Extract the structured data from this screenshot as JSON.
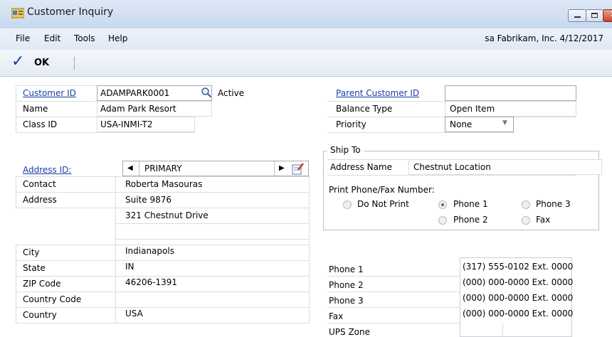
{
  "window": {
    "title": "Customer Inquiry"
  },
  "menu": {
    "file": "File",
    "edit": "Edit",
    "tools": "Tools",
    "help": "Help"
  },
  "status": {
    "company_info": "sa  Fabrikam, Inc. 4/12/2017"
  },
  "toolbar": {
    "ok_label": "OK"
  },
  "customer": {
    "id_label": "Customer ID",
    "id_value": "ADAMPARK0001",
    "status": "Active",
    "name_label": "Name",
    "name_value": "Adam Park Resort",
    "class_label": "Class ID",
    "class_value": "USA-INMI-T2"
  },
  "parent": {
    "parent_label": "Parent Customer ID",
    "parent_value": "",
    "balance_label": "Balance Type",
    "balance_value": "Open Item",
    "priority_label": "Priority",
    "priority_value": "None"
  },
  "address": {
    "id_label": "Address ID:",
    "id_value": "PRIMARY",
    "contact_label": "Contact",
    "contact_value": "Roberta Masouras",
    "address_label": "Address",
    "address_lines": [
      "Suite 9876",
      "321 Chestnut Drive",
      ""
    ],
    "city_label": "City",
    "city_value": "Indianapols",
    "state_label": "State",
    "state_value": "IN",
    "zip_label": "ZIP Code",
    "zip_value": "46206-1391",
    "country_code_label": "Country Code",
    "country_code_value": "",
    "country_label": "Country",
    "country_value": "USA"
  },
  "ship_to": {
    "group_label": "Ship To",
    "address_name_label": "Address Name",
    "address_name_value": "Chestnut Location",
    "print_label": "Print Phone/Fax Number:",
    "options": {
      "do_not_print": "Do Not Print",
      "phone1": "Phone 1",
      "phone2": "Phone 2",
      "phone3": "Phone 3",
      "fax": "Fax"
    },
    "selected": "phone1"
  },
  "phones": {
    "phone1_label": "Phone 1",
    "phone1_value": "(317) 555-0102 Ext. 0000",
    "phone2_label": "Phone 2",
    "phone2_value": "(000) 000-0000 Ext. 0000",
    "phone3_label": "Phone 3",
    "phone3_value": "(000) 000-0000 Ext. 0000",
    "fax_label": "Fax",
    "fax_value": "(000) 000-0000 Ext. 0000",
    "ups_label": "UPS Zone",
    "ups_value": ""
  },
  "icons": {
    "app": "customer-inquiry-app-icon",
    "ok": "checkmark-icon",
    "lookup": "magnifier-lookup-icon",
    "prev": "triangle-left-icon",
    "next": "triangle-right-icon",
    "addr_note": "note-pencil-icon",
    "dropdown": "chevron-down-icon"
  },
  "colors": {
    "link": "#1a3ea8",
    "titlebar": "#c7d8ee",
    "ok_check": "#1a3f9a"
  }
}
